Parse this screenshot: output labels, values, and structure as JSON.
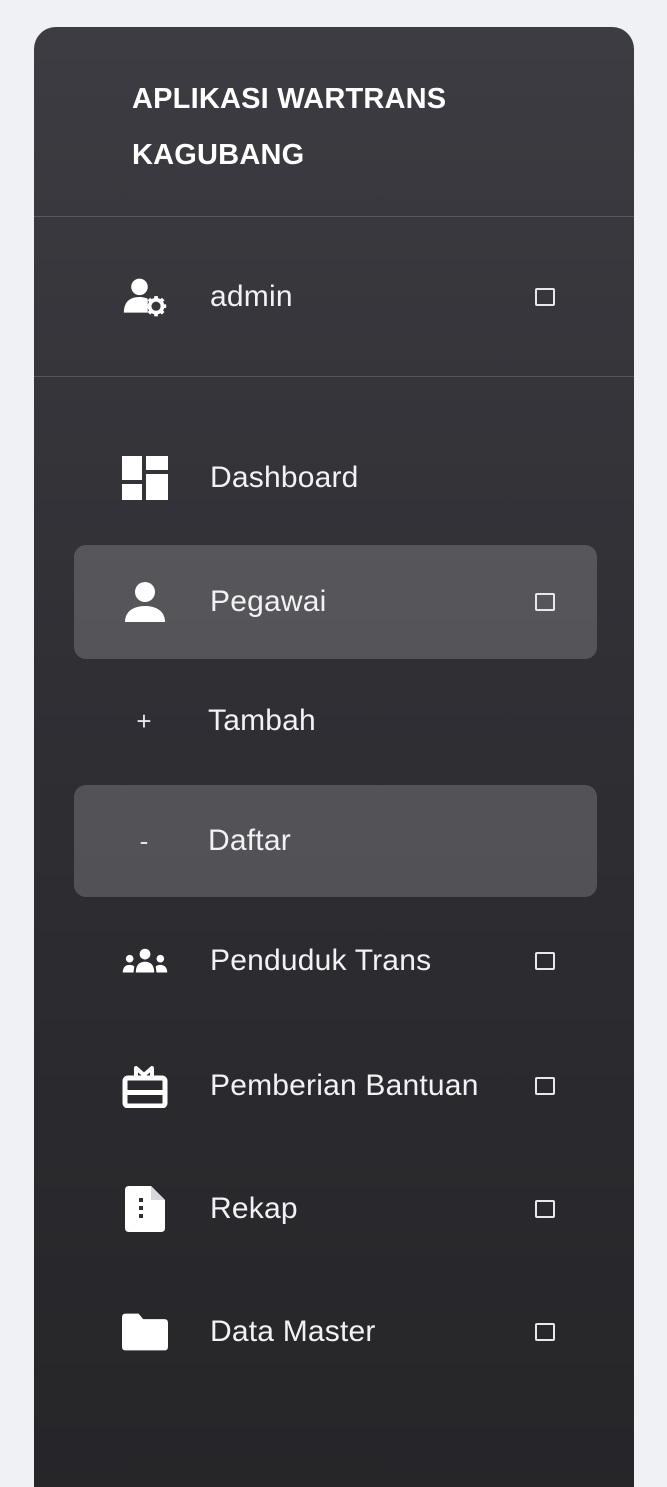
{
  "brand": {
    "title": "APLIKASI WARTRANS KAGUBANG"
  },
  "user": {
    "name": "admin",
    "icon": "user-gear-icon"
  },
  "menu": [
    {
      "label": "Dashboard",
      "icon": "dashboard-icon",
      "expandable": false,
      "active": false
    },
    {
      "label": "Pegawai",
      "icon": "person-icon",
      "expandable": true,
      "active": true,
      "children": [
        {
          "bullet": "+",
          "label": "Tambah",
          "active": false
        },
        {
          "bullet": "-",
          "label": "Daftar",
          "active": true
        }
      ]
    },
    {
      "label": "Penduduk Trans",
      "icon": "group-icon",
      "expandable": true,
      "active": false
    },
    {
      "label": "Pemberian Bantuan",
      "icon": "gift-icon",
      "expandable": true,
      "active": false
    },
    {
      "label": "Rekap",
      "icon": "document-icon",
      "expandable": true,
      "active": false
    },
    {
      "label": "Data Master",
      "icon": "folder-icon",
      "expandable": true,
      "active": false
    }
  ],
  "colors": {
    "sidebar_top": "#3c3c42",
    "sidebar_bottom": "#262629",
    "page_bg": "#eff1f4",
    "active_bg": "rgba(255,255,255,0.18)",
    "text": "#f2f2f4"
  }
}
